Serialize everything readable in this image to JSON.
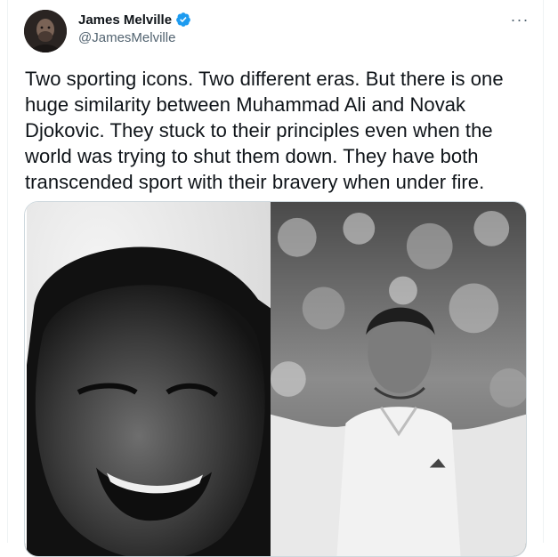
{
  "author": {
    "name": "James Melville",
    "handle": "@JamesMelville",
    "verified": true,
    "avatar_icon": "profile-avatar"
  },
  "menu": {
    "icon": "more-options-icon",
    "glyph": "···"
  },
  "tweet": {
    "text": "Two sporting icons. Two different eras. But there is one\nhuge similarity between Muhammad Ali and Novak\nDjokovic. They stuck to their principles even when the\nworld was trying to shut them down. They have both\ntranscended sport with their bravery when under fire."
  },
  "media": {
    "left_photo": "black-and-white portrait of smiling boxer",
    "right_photo": "black-and-white photo of tennis player celebrating"
  },
  "colors": {
    "text_primary": "#0f1419",
    "text_secondary": "#536471",
    "verified_blue": "#1d9bf0",
    "border": "#cfd9de"
  }
}
